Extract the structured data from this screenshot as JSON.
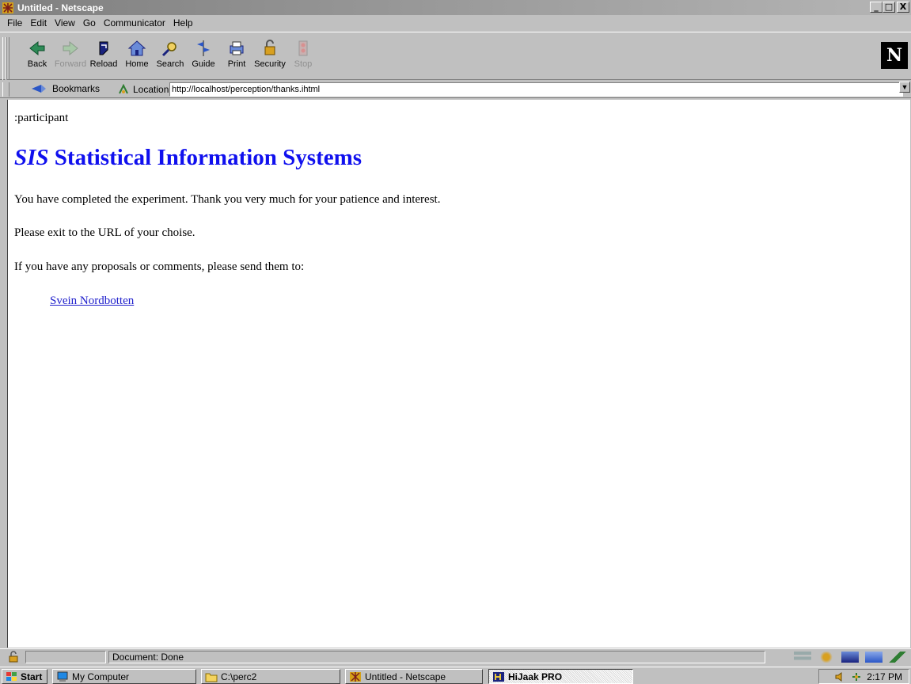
{
  "window": {
    "title": "Untitled - Netscape",
    "buttons": {
      "minimize": "_",
      "maximize": "□",
      "close": "X"
    }
  },
  "menu": [
    "File",
    "Edit",
    "View",
    "Go",
    "Communicator",
    "Help"
  ],
  "toolbar": {
    "buttons": [
      {
        "label": "Back",
        "icon": "back-arrow-icon",
        "enabled": true
      },
      {
        "label": "Forward",
        "icon": "forward-arrow-icon",
        "enabled": false
      },
      {
        "label": "Reload",
        "icon": "reload-icon",
        "enabled": true
      },
      {
        "label": "Home",
        "icon": "home-icon",
        "enabled": true
      },
      {
        "label": "Search",
        "icon": "search-icon",
        "enabled": true
      },
      {
        "label": "Guide",
        "icon": "guide-icon",
        "enabled": true
      },
      {
        "label": "Print",
        "icon": "print-icon",
        "enabled": true
      },
      {
        "label": "Security",
        "icon": "lock-icon",
        "enabled": true
      },
      {
        "label": "Stop",
        "icon": "stop-icon",
        "enabled": false
      }
    ],
    "logo": "N"
  },
  "location_bar": {
    "bookmarks_label": "Bookmarks",
    "location_label": "Location:",
    "url": "http://localhost/perception/thanks.ihtml"
  },
  "page": {
    "participant": ":participant",
    "heading_italic": "SIS",
    "heading_rest": " Statistical Information Systems",
    "paragraphs": [
      "You have completed the experiment. Thank you very much for your patience and interest.",
      "Please exit to the URL of your choise.",
      "If you have any proposals or comments, please send them to:"
    ],
    "link": "Svein Nordbotten"
  },
  "status": {
    "text": "Document: Done"
  },
  "taskbar": {
    "start": "Start",
    "tasks": [
      "My Computer",
      "C:\\perc2",
      "Untitled - Netscape",
      "HiJaak PRO"
    ],
    "time": "2:17 PM"
  },
  "colors": {
    "link": "#2020cc",
    "heading": "#1010ee",
    "chrome": "#c0c0c0"
  }
}
